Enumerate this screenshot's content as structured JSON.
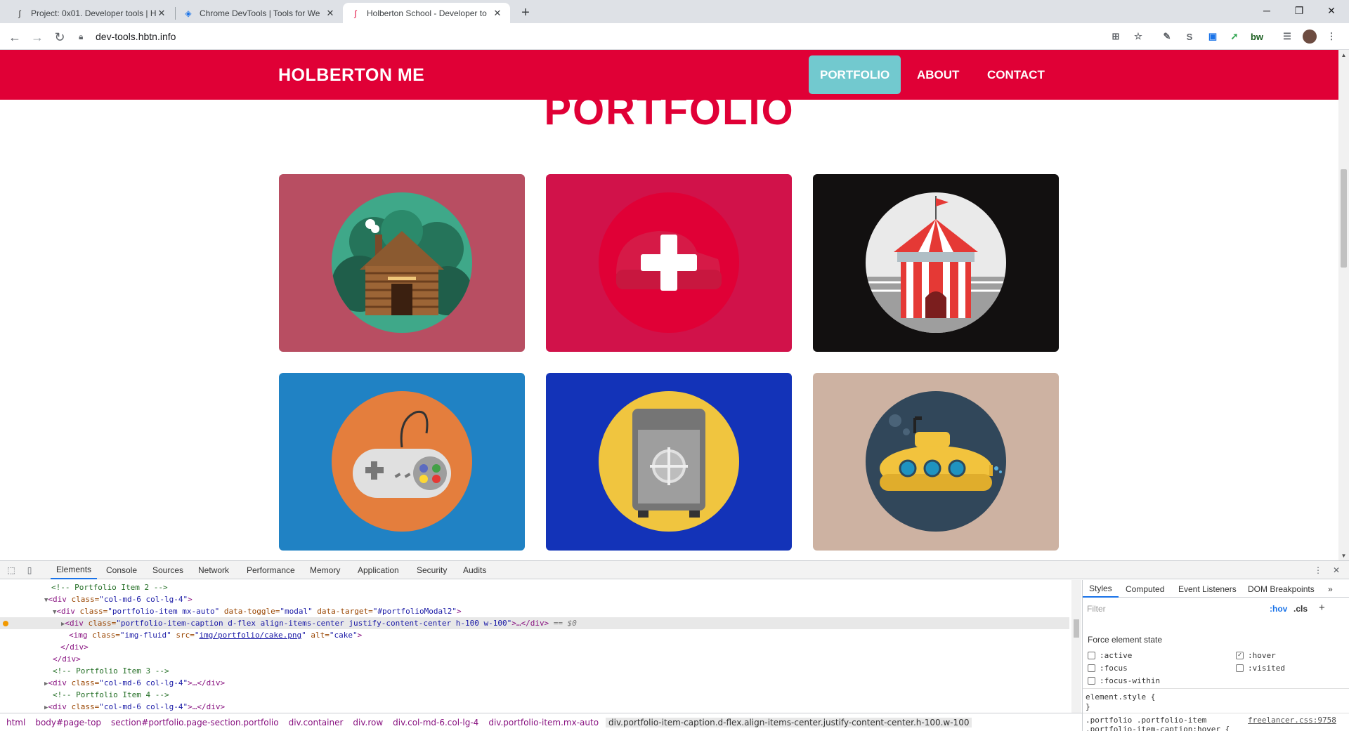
{
  "browser": {
    "tabs": [
      {
        "title": "Project: 0x01. Developer tools | H",
        "favicon": "holberton-icon"
      },
      {
        "title": "Chrome DevTools  |  Tools for We",
        "favicon": "chrome-devtools-icon"
      },
      {
        "title": "Holberton School - Developer to",
        "favicon": "holberton-icon"
      }
    ],
    "url": "dev-tools.hbtn.info"
  },
  "site": {
    "brand": "HOLBERTON ME",
    "nav": [
      "PORTFOLIO",
      "ABOUT",
      "CONTACT"
    ],
    "section_title": "PORTFOLIO",
    "cards": [
      {
        "name": "cabin",
        "bg": "#b84e62",
        "circle": "#3fa889"
      },
      {
        "name": "cake",
        "bg": "#d1124a",
        "circle": "#e00036"
      },
      {
        "name": "circus",
        "bg": "#121010",
        "circle": "#eaeaea"
      },
      {
        "name": "game",
        "bg": "#2082c4",
        "circle": "#e47e3d"
      },
      {
        "name": "safe",
        "bg": "#1333b8",
        "circle": "#f0c53f"
      },
      {
        "name": "submarine",
        "bg": "#cdb2a2",
        "circle": "#31475a"
      }
    ]
  },
  "devtools": {
    "tabs": [
      "Elements",
      "Console",
      "Sources",
      "Network",
      "Performance",
      "Memory",
      "Application",
      "Security",
      "Audits"
    ],
    "elements": {
      "l1": "<!-- Portfolio Item 2 -->",
      "l2_tag": "<div",
      "l2_attr": " class=",
      "l2_val": "\"col-md-6 col-lg-4\"",
      "l2_end": ">",
      "l3_tag": "<div",
      "l3_a1": " class=",
      "l3_v1": "\"portfolio-item mx-auto\"",
      "l3_a2": " data-toggle=",
      "l3_v2": "\"modal\"",
      "l3_a3": " data-target=",
      "l3_v3": "\"#portfolioModal2\"",
      "l3_end": ">",
      "l4_tag": "<div",
      "l4_a1": " class=",
      "l4_v1": "\"portfolio-item-caption d-flex align-items-center justify-content-center h-100 w-100\"",
      "l4_end": ">…</div>",
      "l4_eq": " == $0",
      "l5_tag": "<img",
      "l5_a1": " class=",
      "l5_v1": "\"img-fluid\"",
      "l5_a2": " src=",
      "l5_v2": "img/portfolio/cake.png",
      "l5_a3": " alt=",
      "l5_v3": "\"cake\"",
      "l5_end": ">",
      "l6": "</div>",
      "l7": "</div>",
      "l8": "<!-- Portfolio Item 3 -->",
      "l9_tag": "<div",
      "l9_attr": " class=",
      "l9_val": "\"col-md-6 col-lg-4\"",
      "l9_end": ">…</div>",
      "l10": "<!-- Portfolio Item 4 -->",
      "l11_tag": "<div",
      "l11_attr": " class=",
      "l11_val": "\"col-md-6 col-lg-4\"",
      "l11_end": ">…</div>"
    },
    "breadcrumbs": [
      "html",
      "body#page-top",
      "section#portfolio.page-section.portfolio",
      "div.container",
      "div.row",
      "div.col-md-6.col-lg-4",
      "div.portfolio-item.mx-auto",
      "div.portfolio-item-caption.d-flex.align-items-center.justify-content-center.h-100.w-100"
    ],
    "styles": {
      "tabs": [
        "Styles",
        "Computed",
        "Event Listeners",
        "DOM Breakpoints"
      ],
      "filter_placeholder": "Filter",
      "hov": ":hov",
      "cls": ".cls",
      "force_state_title": "Force element state",
      "states_left": [
        ":active",
        ":focus",
        ":focus-within"
      ],
      "states_right": [
        ":hover",
        ":visited"
      ],
      "element_style": "element.style {",
      "close_brace": "}",
      "rule1": ".portfolio .portfolio-item",
      "rule2": ".portfolio-item-caption:hover {",
      "rule_source": "freelancer.css:9758"
    }
  }
}
